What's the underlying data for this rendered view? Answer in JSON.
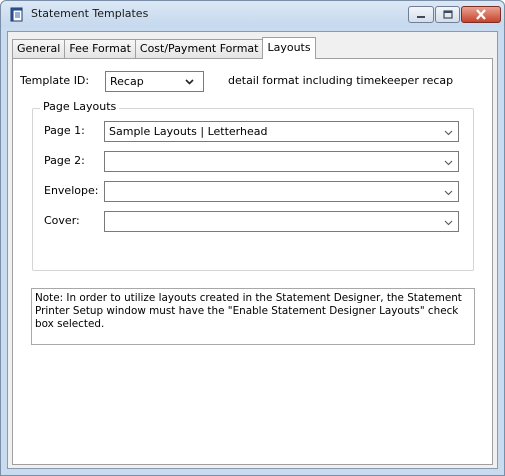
{
  "window": {
    "title": "Statement Templates",
    "icons": {
      "app": "statement-app-icon",
      "minimize": "minimize-icon",
      "maximize": "maximize-icon",
      "close": "close-icon"
    }
  },
  "tabs": [
    {
      "label": "General",
      "active": false
    },
    {
      "label": "Fee Format",
      "active": false
    },
    {
      "label": "Cost/Payment Format",
      "active": false
    },
    {
      "label": "Layouts",
      "active": true
    }
  ],
  "template": {
    "label": "Template ID:",
    "value": "Recap",
    "description": "detail format including timekeeper recap"
  },
  "page_layouts": {
    "title": "Page Layouts",
    "fields": [
      {
        "label": "Page 1:",
        "value": "Sample Layouts | Letterhead"
      },
      {
        "label": "Page 2:",
        "value": ""
      },
      {
        "label": "Envelope:",
        "value": ""
      },
      {
        "label": "Cover:",
        "value": ""
      }
    ]
  },
  "note": "Note: In order to utilize layouts created in the Statement Designer, the Statement Printer Setup window must have the \"Enable Statement Designer Layouts\" check box selected.",
  "colors": {
    "titlebar": "#c5d8ee",
    "close_button": "#c7432c",
    "panel_background": "#ffffff"
  }
}
